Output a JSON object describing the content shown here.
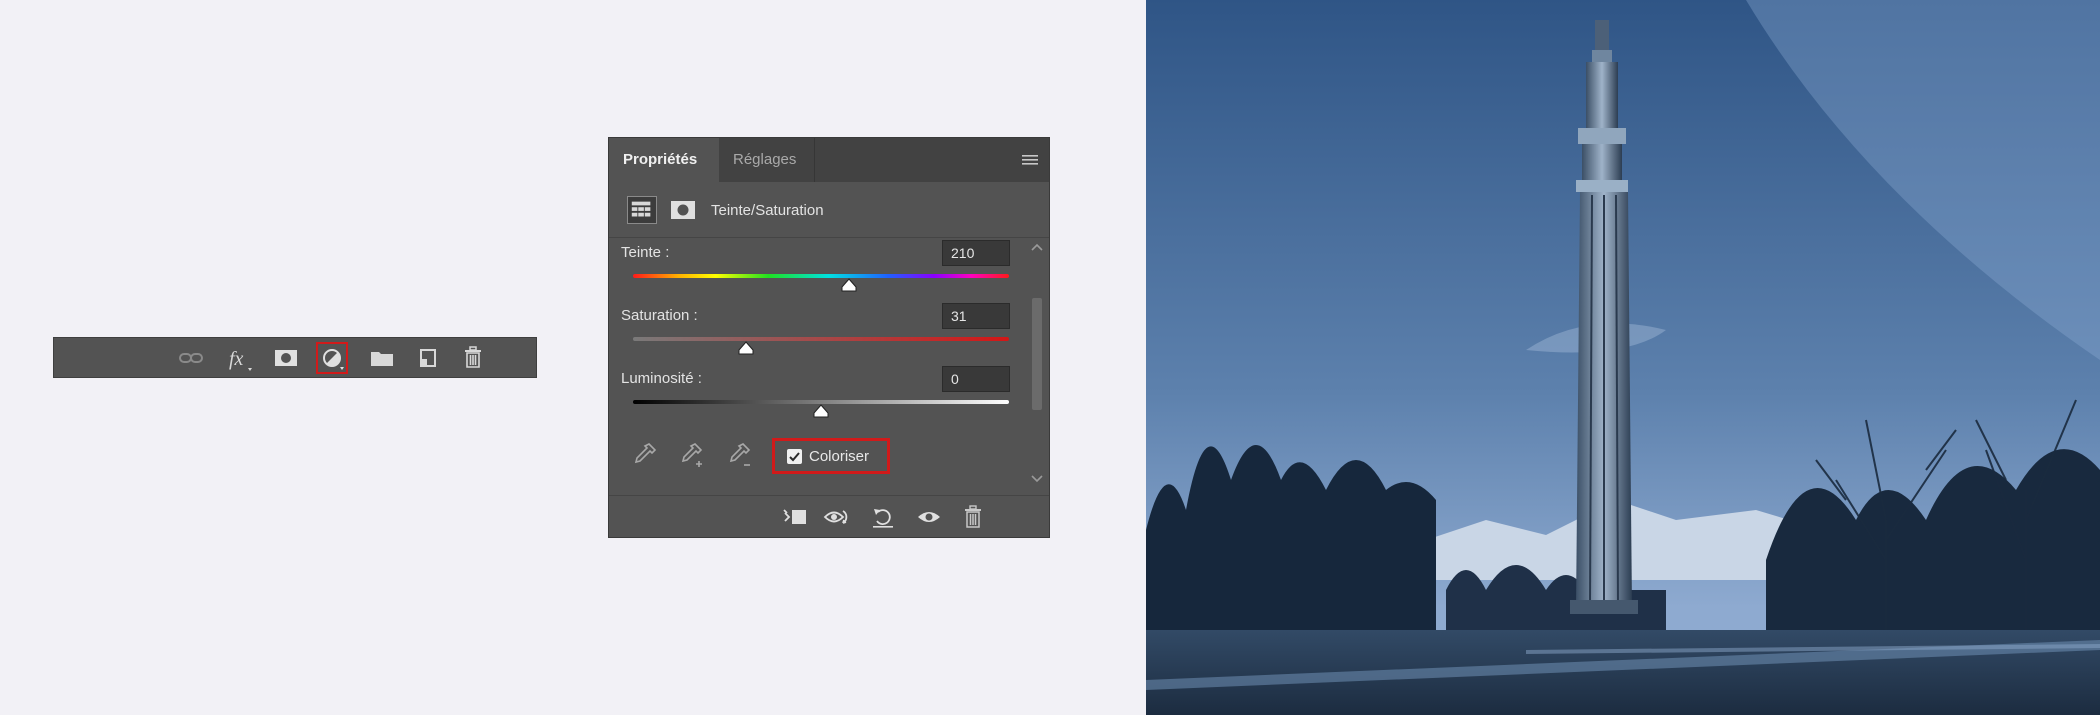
{
  "layers_toolbar": {
    "buttons": [
      {
        "name": "link-layers",
        "icon": "link-icon"
      },
      {
        "name": "layer-style",
        "icon": "fx-icon",
        "label": "fx"
      },
      {
        "name": "add-mask",
        "icon": "mask-icon"
      },
      {
        "name": "new-adjustment-layer",
        "icon": "half-circle-icon",
        "highlighted": true
      },
      {
        "name": "new-group",
        "icon": "folder-icon"
      },
      {
        "name": "new-layer",
        "icon": "new-page-icon"
      },
      {
        "name": "delete-layer",
        "icon": "trash-icon"
      }
    ]
  },
  "properties_panel": {
    "tabs": [
      {
        "label": "Propriétés",
        "active": true
      },
      {
        "label": "Réglages",
        "active": false
      }
    ],
    "adjustment_title": "Teinte/Saturation",
    "fields": {
      "teinte": {
        "label": "Teinte :",
        "value": "210",
        "slider_fraction": 0.575
      },
      "saturation": {
        "label": "Saturation :",
        "value": "31",
        "slider_fraction": 0.3
      },
      "luminosite": {
        "label": "Luminosité :",
        "value": "0",
        "slider_fraction": 0.5
      }
    },
    "colorize": {
      "label": "Coloriser",
      "checked": true,
      "highlight_color": "#d11a1a"
    },
    "footer_buttons": [
      "clip-to-layer-icon",
      "view-previous-icon",
      "reset-icon",
      "visibility-icon",
      "trash-icon"
    ]
  },
  "colors": {
    "page_background": "#f2f1f6",
    "panel_background": "#535353",
    "highlight": "#d11a1a",
    "photo_tint": "#4a6f9c"
  }
}
